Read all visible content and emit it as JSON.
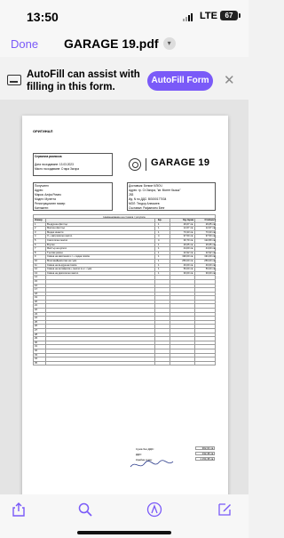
{
  "status": {
    "time": "13:50",
    "network": "LTE",
    "battery": "67"
  },
  "nav": {
    "done_label": "Done",
    "title": "GARAGE 19.pdf"
  },
  "autofill": {
    "message": "AutoFill can assist with filling in this form.",
    "button_label": "AutoFill Form"
  },
  "doc": {
    "original_label": "ОРИГИНАЛ",
    "order": {
      "heading": "Сервизна разписка",
      "date_line": "Дата на издаване: 13.03.2023",
      "place_line": "Място на издаване: Стара Загора"
    },
    "brand": "GARAGE 19",
    "client": {
      "heading": "Получател",
      "address": "Адрес:",
      "make": "Марка: Алфа Ромео",
      "model": "Модел: Мулетта",
      "reg": "Регистрационен номер:",
      "contact": "Контактен:"
    },
    "supplier": {
      "heading": "Доставчик: Белият КЛЮЧ",
      "address": "Адрес: гр. Ст.Загора, \"кв: Монте Кьошк\"",
      "no": "283",
      "vat": "Ид. N по ДДС: BG000177034",
      "mol": "МОЛ: Теодор Алексиев",
      "issuer": "Съставил: Рафаелито Бенг"
    },
    "table": {
      "caption": "Наименование на стоката / услугата",
      "headers": [
        "Номер",
        "",
        "Бр.",
        "Ед. Цена",
        "Стойност"
      ],
      "rows": [
        [
          "1",
          "Въздушен филтър",
          "1",
          "26,67 лв.",
          "26,65 лв."
        ],
        [
          "2",
          "Маслен филтър",
          "1",
          "12,67 лв.",
          "12,67 лв."
        ],
        [
          "3",
          "Медни ишаити",
          "1",
          "73,33 лв.",
          "73,33 лв."
        ],
        [
          "4",
          "Л + матрисално масло",
          "4",
          "97,50 лв.",
          "97,50 лв."
        ],
        [
          "5",
          "Синтетично масло",
          "4",
          "30,70 лв.",
          "122,80 лв."
        ],
        [
          "6",
          "Втулки",
          "1",
          "26,65 лв.",
          "26,65 лв."
        ],
        [
          "7",
          "Филтър на купето",
          "1",
          "44,00 лв.",
          "44,00 лв."
        ],
        [
          "8",
          "Тънтам ремък",
          "1",
          "22,92 лв.",
          "22,92 лв."
        ],
        [
          "9",
          "Смяна на масления к-т + задна помпа",
          "1",
          "190,00 лв.",
          "191,00 лв."
        ],
        [
          "10",
          "Монтаж/Демонтаж на гуми",
          "1",
          "250,00 лв.",
          "250,00 лв."
        ],
        [
          "11",
          "Смяна на въздушна помпа",
          "1",
          "40,00 лв.",
          "40,00 лв."
        ],
        [
          "12",
          "Смяна на антифриза + масло в к-т. гуми",
          "1",
          "50,00 лв.",
          "50,00 лв."
        ],
        [
          "13",
          "Смяна на двигателно масло",
          "1",
          "30,00 лв.",
          "30,00 лв."
        ],
        [
          "14",
          "",
          "",
          "",
          ""
        ],
        [
          "15",
          "",
          "",
          "",
          ""
        ],
        [
          "16",
          "",
          "",
          "",
          ""
        ],
        [
          "17",
          "",
          "",
          "",
          ""
        ],
        [
          "18",
          "",
          "",
          "",
          ""
        ],
        [
          "19",
          "",
          "",
          "",
          ""
        ],
        [
          "20",
          "",
          "",
          "",
          ""
        ],
        [
          "21",
          "",
          "",
          "",
          ""
        ],
        [
          "22",
          "",
          "",
          "",
          ""
        ],
        [
          "23",
          "",
          "",
          "",
          ""
        ],
        [
          "24",
          "",
          "",
          "",
          ""
        ],
        [
          "25",
          "",
          "",
          "",
          ""
        ],
        [
          "26",
          "",
          "",
          "",
          ""
        ],
        [
          "27",
          "",
          "",
          "",
          ""
        ],
        [
          "28",
          "",
          "",
          "",
          ""
        ],
        [
          "29",
          "",
          "",
          "",
          ""
        ],
        [
          "30",
          "",
          "",
          "",
          ""
        ],
        [
          "31",
          "",
          "",
          "",
          ""
        ],
        [
          "32",
          "",
          "",
          "",
          ""
        ],
        [
          "33",
          "",
          "",
          "",
          ""
        ],
        [
          "34",
          "",
          "",
          "",
          ""
        ],
        [
          "35",
          "",
          "",
          "",
          ""
        ]
      ]
    },
    "totals": {
      "net_label": "Сума без ДДС:",
      "net_value": "962,00 лв.",
      "vat_label": "ДДС:",
      "vat_value": "192,38 лв.",
      "total_label": "Крайна сума:",
      "total_value": "1 154,38 лв."
    }
  },
  "toolbar": {
    "icons": [
      "share-icon",
      "search-icon",
      "markup-icon",
      "edit-icon"
    ]
  },
  "colors": {
    "accent": "#7a5af8"
  }
}
